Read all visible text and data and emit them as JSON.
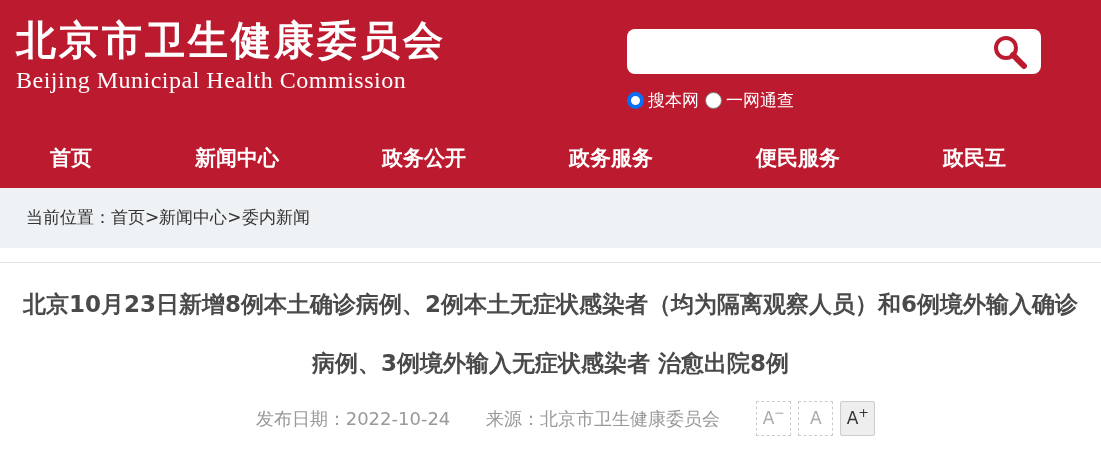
{
  "header": {
    "title": "北京市卫生健康委员会",
    "subtitle": "Beijing Municipal Health Commission"
  },
  "search": {
    "scopes": [
      {
        "label": "搜本网",
        "selected": true
      },
      {
        "label": "一网通查",
        "selected": false
      }
    ]
  },
  "nav": [
    "首页",
    "新闻中心",
    "政务公开",
    "政务服务",
    "便民服务",
    "政民互"
  ],
  "breadcrumb": {
    "label": "当前位置：",
    "items": [
      "首页",
      ">",
      "新闻中心",
      ">",
      "委内新闻"
    ]
  },
  "article": {
    "title": "北京10月23日新增8例本土确诊病例、2例本土无症状感染者（均为隔离观察人员）和6例境外输入确诊病例、3例境外输入无症状感染者 治愈出院8例",
    "date": "发布日期：2022-10-24",
    "source": "来源：北京市卫生健康委员会",
    "font_sizes": [
      {
        "label": "A$^{−}$",
        "selected": false
      },
      {
        "label": "A",
        "selected": false
      },
      {
        "label": "A$^{+}$",
        "selected": true
      }
    ]
  }
}
